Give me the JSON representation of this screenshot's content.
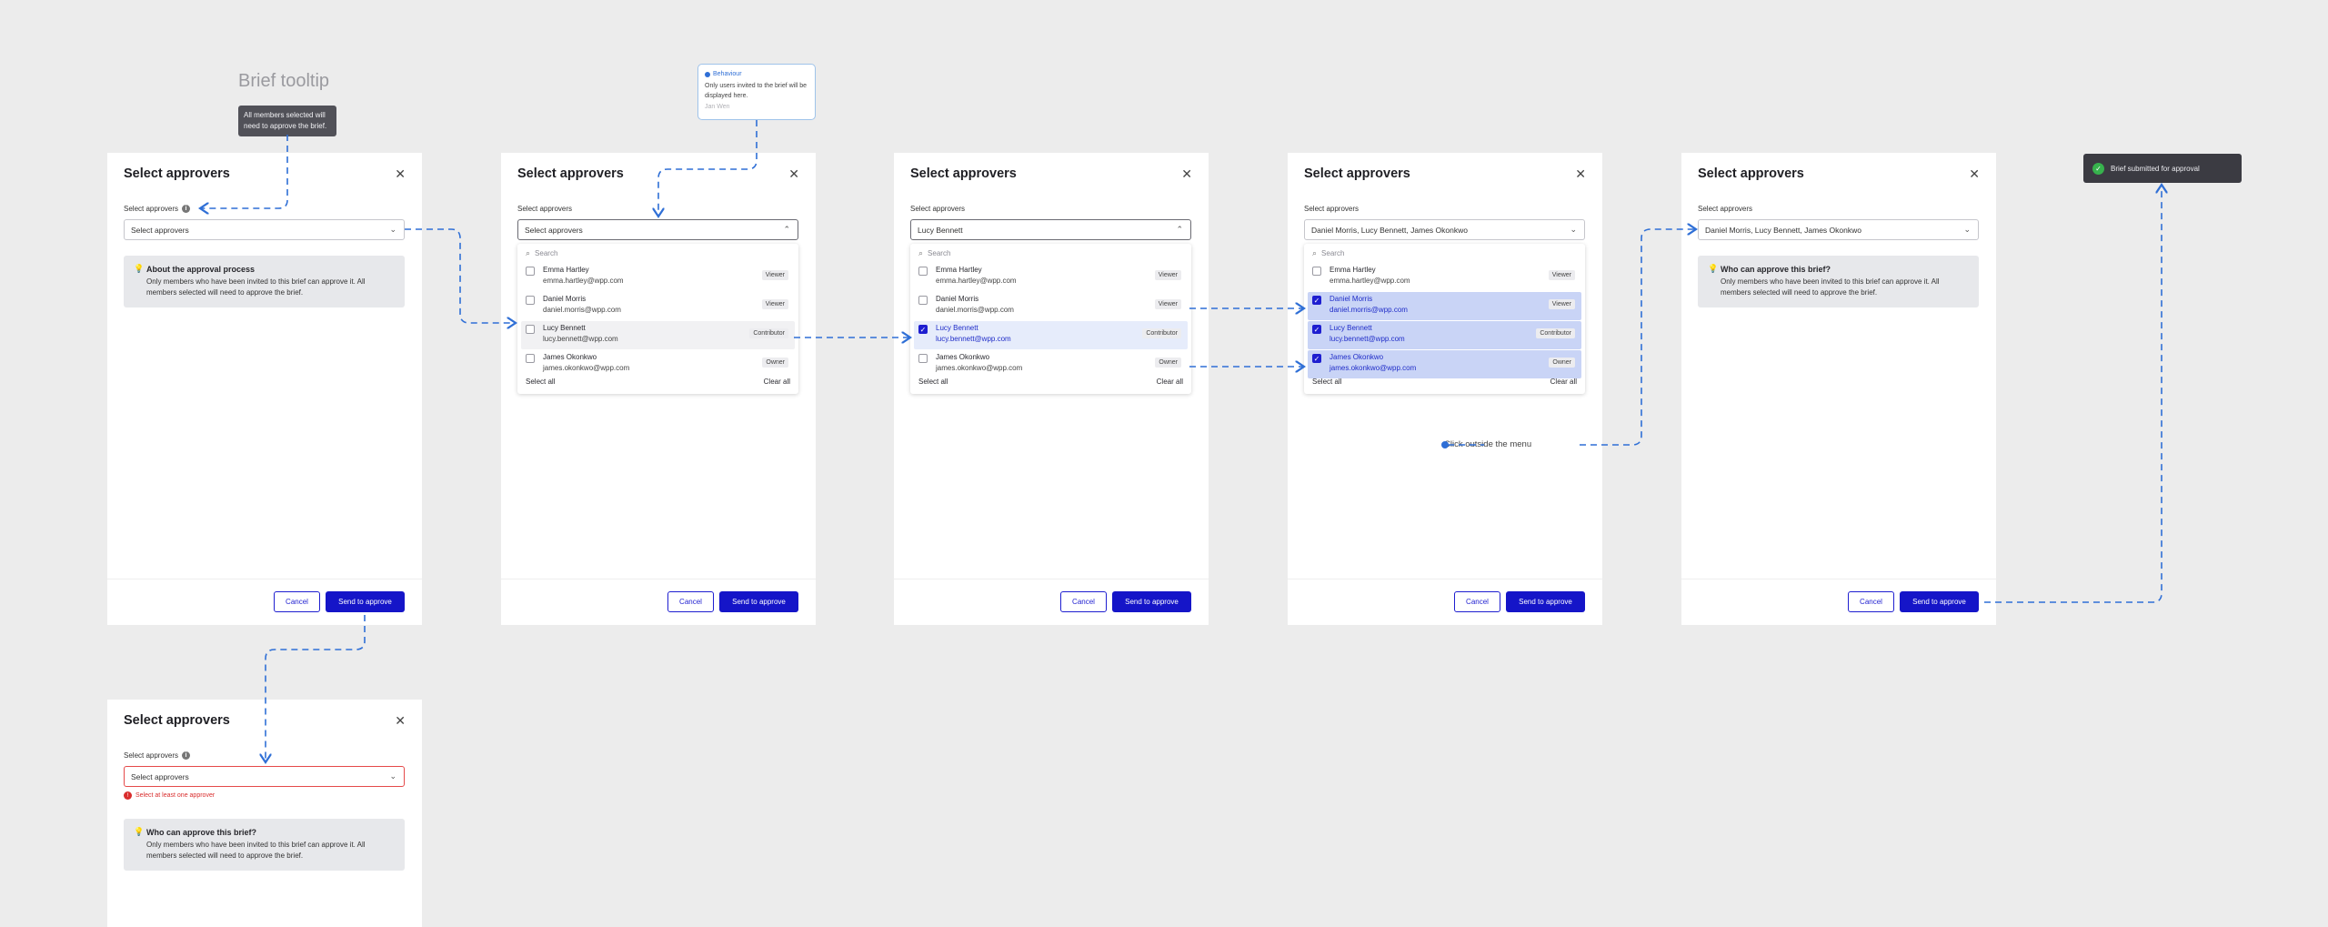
{
  "canvas": {
    "title": "Brief tooltip"
  },
  "tooltip": {
    "text": "All members selected will need to approve the brief."
  },
  "note": {
    "title": "Behaviour",
    "body": "Only users invited to the brief will be displayed here.",
    "meta": "Jan Wen"
  },
  "toast": {
    "text": "Brief submitted for approval"
  },
  "click_outside": "Click outside the menu",
  "common": {
    "title": "Select approvers",
    "field_label": "Select approvers",
    "placeholder": "Select approvers",
    "search_placeholder": "Search",
    "select_all": "Select all",
    "clear_all": "Clear all",
    "cancel": "Cancel",
    "send": "Send to approve",
    "close": "✕"
  },
  "modals": [
    {
      "select_value": "Select approvers",
      "info_title": "About the approval process",
      "info_text": "Only members who have been invited to this brief can approve it. All members selected will need to approve the brief."
    },
    {
      "select_value": "Select approvers"
    },
    {
      "select_value": "Lucy Bennett"
    },
    {
      "select_value": "Daniel Morris, Lucy Bennett, James Okonkwo"
    },
    {
      "select_value": "Daniel Morris, Lucy Bennett, James Okonkwo",
      "info_title": "Who can approve this brief?",
      "info_text": "Only members who have been invited to this brief can approve it. All members selected will need to approve the brief."
    },
    {
      "select_value": "Select approvers",
      "error": "Select at least one approver",
      "info_title": "Who can approve this brief?",
      "info_text": "Only members who have been invited to this brief can approve it. All members selected will need to approve the brief."
    }
  ],
  "members": [
    {
      "name": "Emma Hartley",
      "email": "emma.hartley@wpp.com",
      "role": "Viewer"
    },
    {
      "name": "Daniel Morris",
      "email": "daniel.morris@wpp.com",
      "role": "Viewer"
    },
    {
      "name": "Lucy Bennett",
      "email": "lucy.bennett@wpp.com",
      "role": "Contributor"
    },
    {
      "name": "James Okonkwo",
      "email": "james.okonkwo@wpp.com",
      "role": "Owner"
    }
  ],
  "selection_states": {
    "modal2": [
      false,
      false,
      false,
      false
    ],
    "modal3": [
      false,
      false,
      true,
      false
    ],
    "modal4": [
      false,
      true,
      true,
      true
    ]
  },
  "colors": {
    "primary": "#1515c8",
    "connector": "#2f6fd6",
    "error": "#d92d2d",
    "selected_row": "#c9d4f6"
  }
}
